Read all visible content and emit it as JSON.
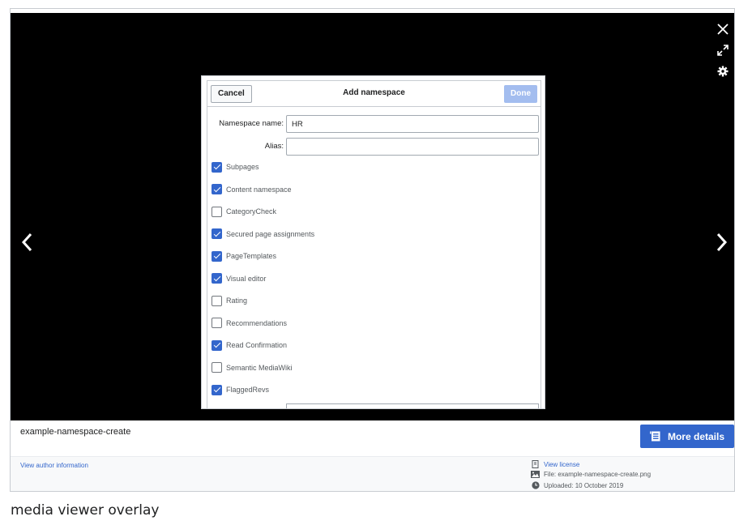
{
  "dialog": {
    "cancel_label": "Cancel",
    "title": "Add namespace",
    "done_label": "Done",
    "namespace_label": "Namespace name:",
    "namespace_value": "HR",
    "alias_label": "Alias:",
    "alias_value": "",
    "options": [
      {
        "label": "Subpages",
        "checked": true
      },
      {
        "label": "Content namespace",
        "checked": true
      },
      {
        "label": "CategoryCheck",
        "checked": false
      },
      {
        "label": "Secured page assignments",
        "checked": true
      },
      {
        "label": "PageTemplates",
        "checked": true
      },
      {
        "label": "Visual editor",
        "checked": true
      },
      {
        "label": "Rating",
        "checked": false
      },
      {
        "label": "Recommendations",
        "checked": false
      },
      {
        "label": "Read Confirmation",
        "checked": true
      },
      {
        "label": "Semantic MediaWiki",
        "checked": false
      },
      {
        "label": "FlaggedRevs",
        "checked": true
      }
    ]
  },
  "viewer": {
    "controls": [
      "close-icon",
      "fullscreen-icon",
      "settings-icon",
      "prev-arrow-icon",
      "next-arrow-icon"
    ],
    "filename": "example-namespace-create",
    "more_details_label": "More details",
    "author_link": "View author information",
    "license_link": "View license",
    "file_info": "File: example-namespace-create.png",
    "uploaded_info": "Uploaded: 10 October 2019"
  },
  "caption": "media viewer overlay",
  "colors": {
    "accent": "#3366cc",
    "done_disabled": "#a3bdef",
    "stage": "#000000"
  }
}
